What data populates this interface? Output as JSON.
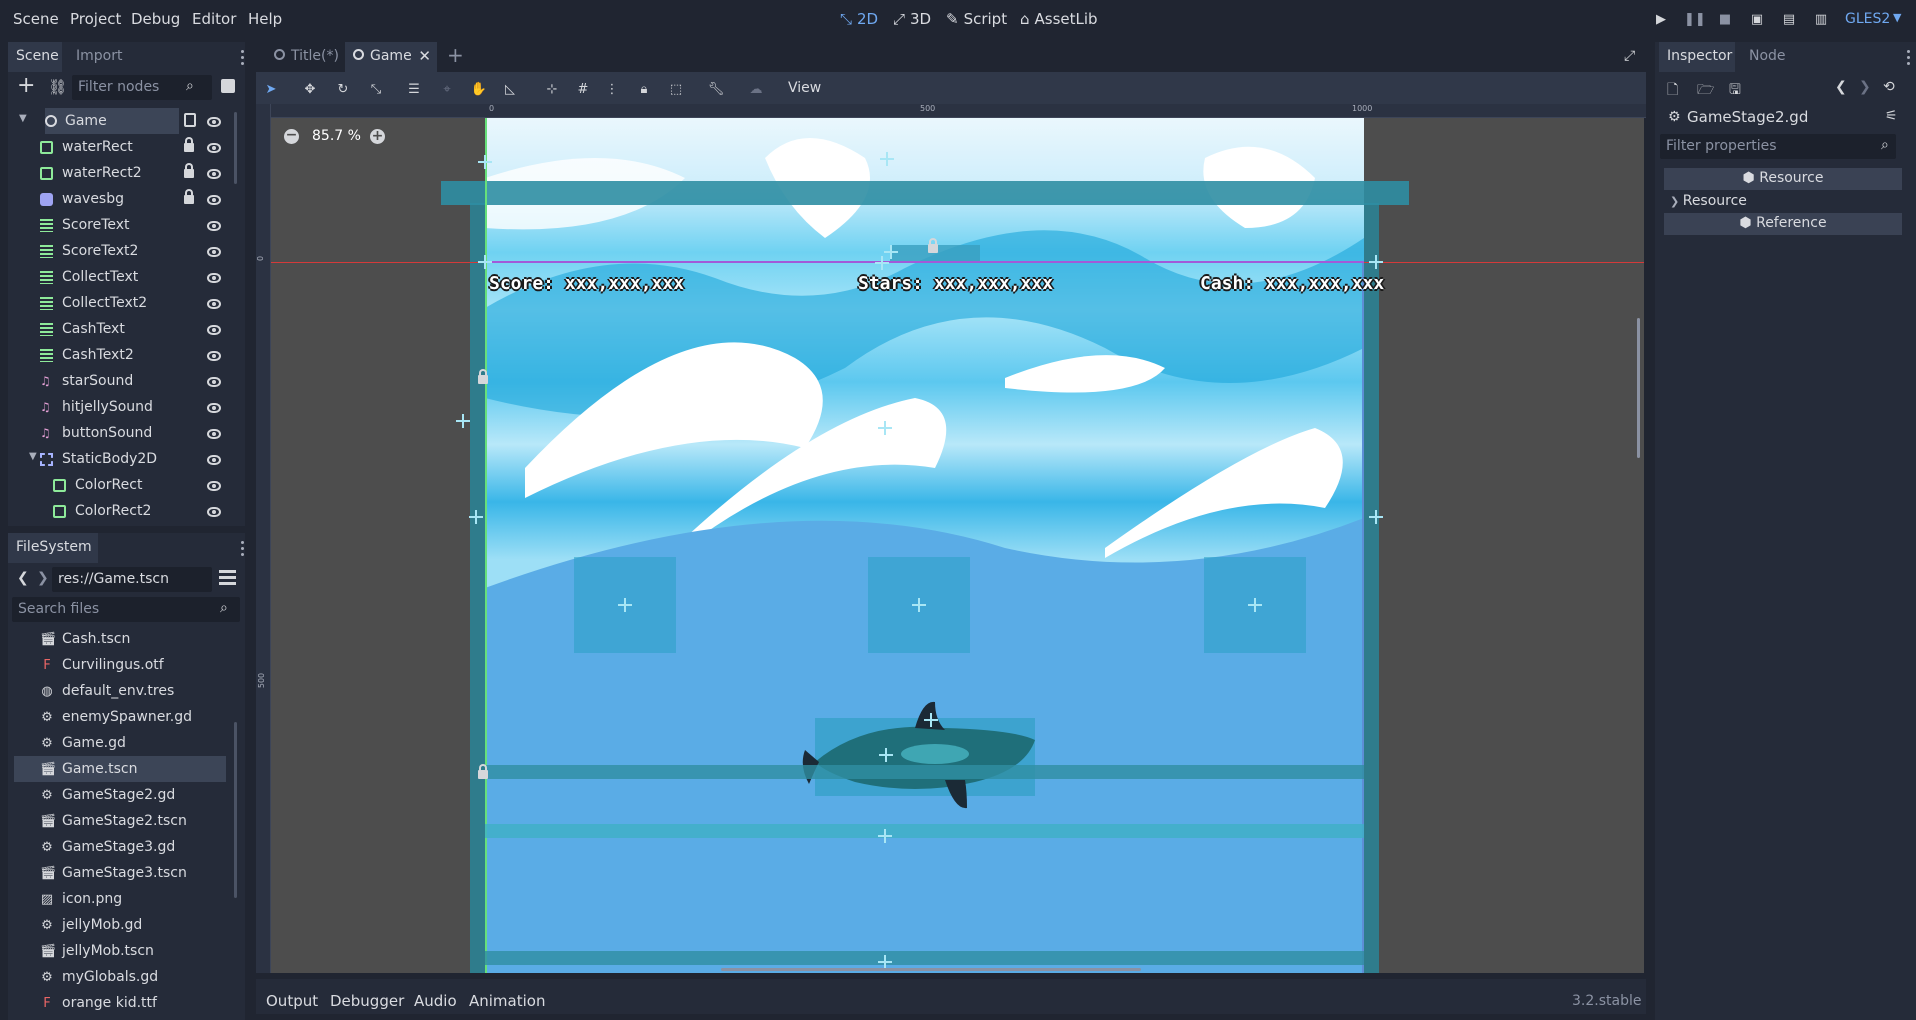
{
  "menu": [
    "Scene",
    "Project",
    "Debug",
    "Editor",
    "Help"
  ],
  "modes": [
    {
      "label": "2D",
      "icon": "2d-icon",
      "active": true
    },
    {
      "label": "3D",
      "icon": "3d-icon"
    },
    {
      "label": "Script",
      "icon": "script-icon"
    },
    {
      "label": "AssetLib",
      "icon": "assetlib-icon"
    }
  ],
  "renderer": "GLES2",
  "scene_panel": {
    "tabs": [
      "Scene",
      "Import"
    ],
    "filter_placeholder": "Filter nodes",
    "nodes": [
      {
        "name": "Game",
        "icon": "node2d-icon",
        "selected": true,
        "script": true
      },
      {
        "name": "waterRect",
        "icon": "colorrect-icon",
        "locked": true
      },
      {
        "name": "waterRect2",
        "icon": "colorrect-icon",
        "locked": true
      },
      {
        "name": "wavesbg",
        "icon": "sprite-icon",
        "locked": true
      },
      {
        "name": "ScoreText",
        "icon": "label-icon"
      },
      {
        "name": "ScoreText2",
        "icon": "label-icon"
      },
      {
        "name": "CollectText",
        "icon": "label-icon"
      },
      {
        "name": "CollectText2",
        "icon": "label-icon"
      },
      {
        "name": "CashText",
        "icon": "label-icon"
      },
      {
        "name": "CashText2",
        "icon": "label-icon"
      },
      {
        "name": "starSound",
        "icon": "audio-icon"
      },
      {
        "name": "hitjellySound",
        "icon": "audio-icon"
      },
      {
        "name": "buttonSound",
        "icon": "audio-icon"
      },
      {
        "name": "StaticBody2D",
        "icon": "staticbody-icon",
        "expanded": true
      },
      {
        "name": "ColorRect",
        "icon": "colorrect-icon",
        "child": true
      },
      {
        "name": "ColorRect2",
        "icon": "colorrect-icon",
        "child": true
      }
    ]
  },
  "filesystem": {
    "tab": "FileSystem",
    "path": "res://Game.tscn",
    "search_placeholder": "Search files",
    "files": [
      {
        "name": "Cash.tscn",
        "icon": "scene-file-icon"
      },
      {
        "name": "Curvilingus.otf",
        "icon": "font-file-icon"
      },
      {
        "name": "default_env.tres",
        "icon": "environment-file-icon"
      },
      {
        "name": "enemySpawner.gd",
        "icon": "gdscript-file-icon"
      },
      {
        "name": "Game.gd",
        "icon": "gdscript-file-icon"
      },
      {
        "name": "Game.tscn",
        "icon": "scene-file-icon",
        "selected": true
      },
      {
        "name": "GameStage2.gd",
        "icon": "gdscript-file-icon"
      },
      {
        "name": "GameStage2.tscn",
        "icon": "scene-file-icon"
      },
      {
        "name": "GameStage3.gd",
        "icon": "gdscript-file-icon"
      },
      {
        "name": "GameStage3.tscn",
        "icon": "scene-file-icon"
      },
      {
        "name": "icon.png",
        "icon": "image-file-icon"
      },
      {
        "name": "jellyMob.gd",
        "icon": "gdscript-file-icon"
      },
      {
        "name": "jellyMob.tscn",
        "icon": "scene-file-icon"
      },
      {
        "name": "myGlobals.gd",
        "icon": "gdscript-file-icon"
      },
      {
        "name": "orange kid.ttf",
        "icon": "font-file-icon"
      }
    ]
  },
  "editor_tabs": [
    {
      "label": "Title(*)",
      "active": false
    },
    {
      "label": "Game",
      "active": true
    }
  ],
  "toolbar": {
    "view_label": "View"
  },
  "viewport": {
    "zoom": "85.7 %",
    "ruler_marks": [
      "0",
      "500",
      "1000"
    ],
    "vruler_marks": [
      "0",
      "500"
    ],
    "hud": {
      "score": "Score: xxx,xxx,xxx",
      "stars": "Stars: xxx,xxx,xxx",
      "cash": "Cash: xxx,xxx,xxx"
    }
  },
  "inspector": {
    "tabs": [
      "Inspector",
      "Node"
    ],
    "resource_name": "GameStage2.gd",
    "filter_placeholder": "Filter properties",
    "sections": [
      {
        "label": "Resource",
        "type": "header"
      },
      {
        "label": "Resource",
        "type": "collapsed"
      },
      {
        "label": "Reference",
        "type": "header"
      }
    ]
  },
  "bottom_tabs": [
    "Output",
    "Debugger",
    "Audio",
    "Animation"
  ],
  "version": "3.2.stable",
  "colors": {
    "accent": "#6fa8f0",
    "bg": "#202531",
    "panel": "#252b39",
    "water_deep": "#5aace6",
    "water_light": "#cfeefb",
    "guide_red": "#d43a3a",
    "guide_purple": "#a25ad8"
  }
}
